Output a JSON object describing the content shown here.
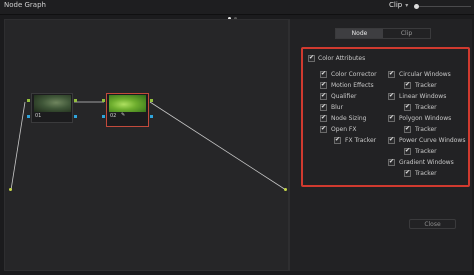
{
  "window": {
    "title": "Node Graph"
  },
  "clip_selector": {
    "label": "Clip",
    "chevron_icon": "chevron-down-icon"
  },
  "nodes": [
    {
      "label": "01"
    },
    {
      "label": "02",
      "icon": "pencil-icon"
    }
  ],
  "panel": {
    "tabs": [
      {
        "label": "Node",
        "selected": true
      },
      {
        "label": "Clip",
        "selected": false
      }
    ],
    "header": {
      "label": "Color Attributes",
      "checked": true
    },
    "left_items": [
      {
        "label": "Color Corrector",
        "checked": true
      },
      {
        "label": "Motion Effects",
        "checked": true
      },
      {
        "label": "Qualifier",
        "checked": true
      },
      {
        "label": "Blur",
        "checked": true
      },
      {
        "label": "Node Sizing",
        "checked": true
      },
      {
        "label": "Open FX",
        "checked": true
      },
      {
        "label": "FX Tracker",
        "checked": true
      }
    ],
    "right_items": [
      {
        "label": "Circular Windows",
        "checked": true
      },
      {
        "label": "Tracker",
        "checked": true
      },
      {
        "label": "Linear Windows",
        "checked": true
      },
      {
        "label": "Tracker",
        "checked": true
      },
      {
        "label": "Polygon Windows",
        "checked": true
      },
      {
        "label": "Tracker",
        "checked": true
      },
      {
        "label": "Power Curve Windows",
        "checked": true
      },
      {
        "label": "Tracker",
        "checked": true
      },
      {
        "label": "Gradient Windows",
        "checked": true
      },
      {
        "label": "Tracker",
        "checked": true
      }
    ],
    "close_label": "Close",
    "highlight_color": "#d13a2f"
  }
}
